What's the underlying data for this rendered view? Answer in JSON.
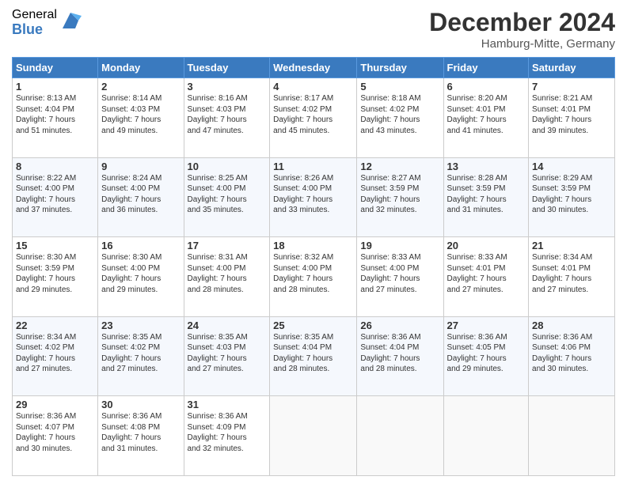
{
  "logo": {
    "general": "General",
    "blue": "Blue"
  },
  "title": "December 2024",
  "location": "Hamburg-Mitte, Germany",
  "days_of_week": [
    "Sunday",
    "Monday",
    "Tuesday",
    "Wednesday",
    "Thursday",
    "Friday",
    "Saturday"
  ],
  "weeks": [
    [
      {
        "day": "1",
        "info": "Sunrise: 8:13 AM\nSunset: 4:04 PM\nDaylight: 7 hours\nand 51 minutes."
      },
      {
        "day": "2",
        "info": "Sunrise: 8:14 AM\nSunset: 4:03 PM\nDaylight: 7 hours\nand 49 minutes."
      },
      {
        "day": "3",
        "info": "Sunrise: 8:16 AM\nSunset: 4:03 PM\nDaylight: 7 hours\nand 47 minutes."
      },
      {
        "day": "4",
        "info": "Sunrise: 8:17 AM\nSunset: 4:02 PM\nDaylight: 7 hours\nand 45 minutes."
      },
      {
        "day": "5",
        "info": "Sunrise: 8:18 AM\nSunset: 4:02 PM\nDaylight: 7 hours\nand 43 minutes."
      },
      {
        "day": "6",
        "info": "Sunrise: 8:20 AM\nSunset: 4:01 PM\nDaylight: 7 hours\nand 41 minutes."
      },
      {
        "day": "7",
        "info": "Sunrise: 8:21 AM\nSunset: 4:01 PM\nDaylight: 7 hours\nand 39 minutes."
      }
    ],
    [
      {
        "day": "8",
        "info": "Sunrise: 8:22 AM\nSunset: 4:00 PM\nDaylight: 7 hours\nand 37 minutes."
      },
      {
        "day": "9",
        "info": "Sunrise: 8:24 AM\nSunset: 4:00 PM\nDaylight: 7 hours\nand 36 minutes."
      },
      {
        "day": "10",
        "info": "Sunrise: 8:25 AM\nSunset: 4:00 PM\nDaylight: 7 hours\nand 35 minutes."
      },
      {
        "day": "11",
        "info": "Sunrise: 8:26 AM\nSunset: 4:00 PM\nDaylight: 7 hours\nand 33 minutes."
      },
      {
        "day": "12",
        "info": "Sunrise: 8:27 AM\nSunset: 3:59 PM\nDaylight: 7 hours\nand 32 minutes."
      },
      {
        "day": "13",
        "info": "Sunrise: 8:28 AM\nSunset: 3:59 PM\nDaylight: 7 hours\nand 31 minutes."
      },
      {
        "day": "14",
        "info": "Sunrise: 8:29 AM\nSunset: 3:59 PM\nDaylight: 7 hours\nand 30 minutes."
      }
    ],
    [
      {
        "day": "15",
        "info": "Sunrise: 8:30 AM\nSunset: 3:59 PM\nDaylight: 7 hours\nand 29 minutes."
      },
      {
        "day": "16",
        "info": "Sunrise: 8:30 AM\nSunset: 4:00 PM\nDaylight: 7 hours\nand 29 minutes."
      },
      {
        "day": "17",
        "info": "Sunrise: 8:31 AM\nSunset: 4:00 PM\nDaylight: 7 hours\nand 28 minutes."
      },
      {
        "day": "18",
        "info": "Sunrise: 8:32 AM\nSunset: 4:00 PM\nDaylight: 7 hours\nand 28 minutes."
      },
      {
        "day": "19",
        "info": "Sunrise: 8:33 AM\nSunset: 4:00 PM\nDaylight: 7 hours\nand 27 minutes."
      },
      {
        "day": "20",
        "info": "Sunrise: 8:33 AM\nSunset: 4:01 PM\nDaylight: 7 hours\nand 27 minutes."
      },
      {
        "day": "21",
        "info": "Sunrise: 8:34 AM\nSunset: 4:01 PM\nDaylight: 7 hours\nand 27 minutes."
      }
    ],
    [
      {
        "day": "22",
        "info": "Sunrise: 8:34 AM\nSunset: 4:02 PM\nDaylight: 7 hours\nand 27 minutes."
      },
      {
        "day": "23",
        "info": "Sunrise: 8:35 AM\nSunset: 4:02 PM\nDaylight: 7 hours\nand 27 minutes."
      },
      {
        "day": "24",
        "info": "Sunrise: 8:35 AM\nSunset: 4:03 PM\nDaylight: 7 hours\nand 27 minutes."
      },
      {
        "day": "25",
        "info": "Sunrise: 8:35 AM\nSunset: 4:04 PM\nDaylight: 7 hours\nand 28 minutes."
      },
      {
        "day": "26",
        "info": "Sunrise: 8:36 AM\nSunset: 4:04 PM\nDaylight: 7 hours\nand 28 minutes."
      },
      {
        "day": "27",
        "info": "Sunrise: 8:36 AM\nSunset: 4:05 PM\nDaylight: 7 hours\nand 29 minutes."
      },
      {
        "day": "28",
        "info": "Sunrise: 8:36 AM\nSunset: 4:06 PM\nDaylight: 7 hours\nand 30 minutes."
      }
    ],
    [
      {
        "day": "29",
        "info": "Sunrise: 8:36 AM\nSunset: 4:07 PM\nDaylight: 7 hours\nand 30 minutes."
      },
      {
        "day": "30",
        "info": "Sunrise: 8:36 AM\nSunset: 4:08 PM\nDaylight: 7 hours\nand 31 minutes."
      },
      {
        "day": "31",
        "info": "Sunrise: 8:36 AM\nSunset: 4:09 PM\nDaylight: 7 hours\nand 32 minutes."
      },
      {
        "day": "",
        "info": ""
      },
      {
        "day": "",
        "info": ""
      },
      {
        "day": "",
        "info": ""
      },
      {
        "day": "",
        "info": ""
      }
    ]
  ]
}
